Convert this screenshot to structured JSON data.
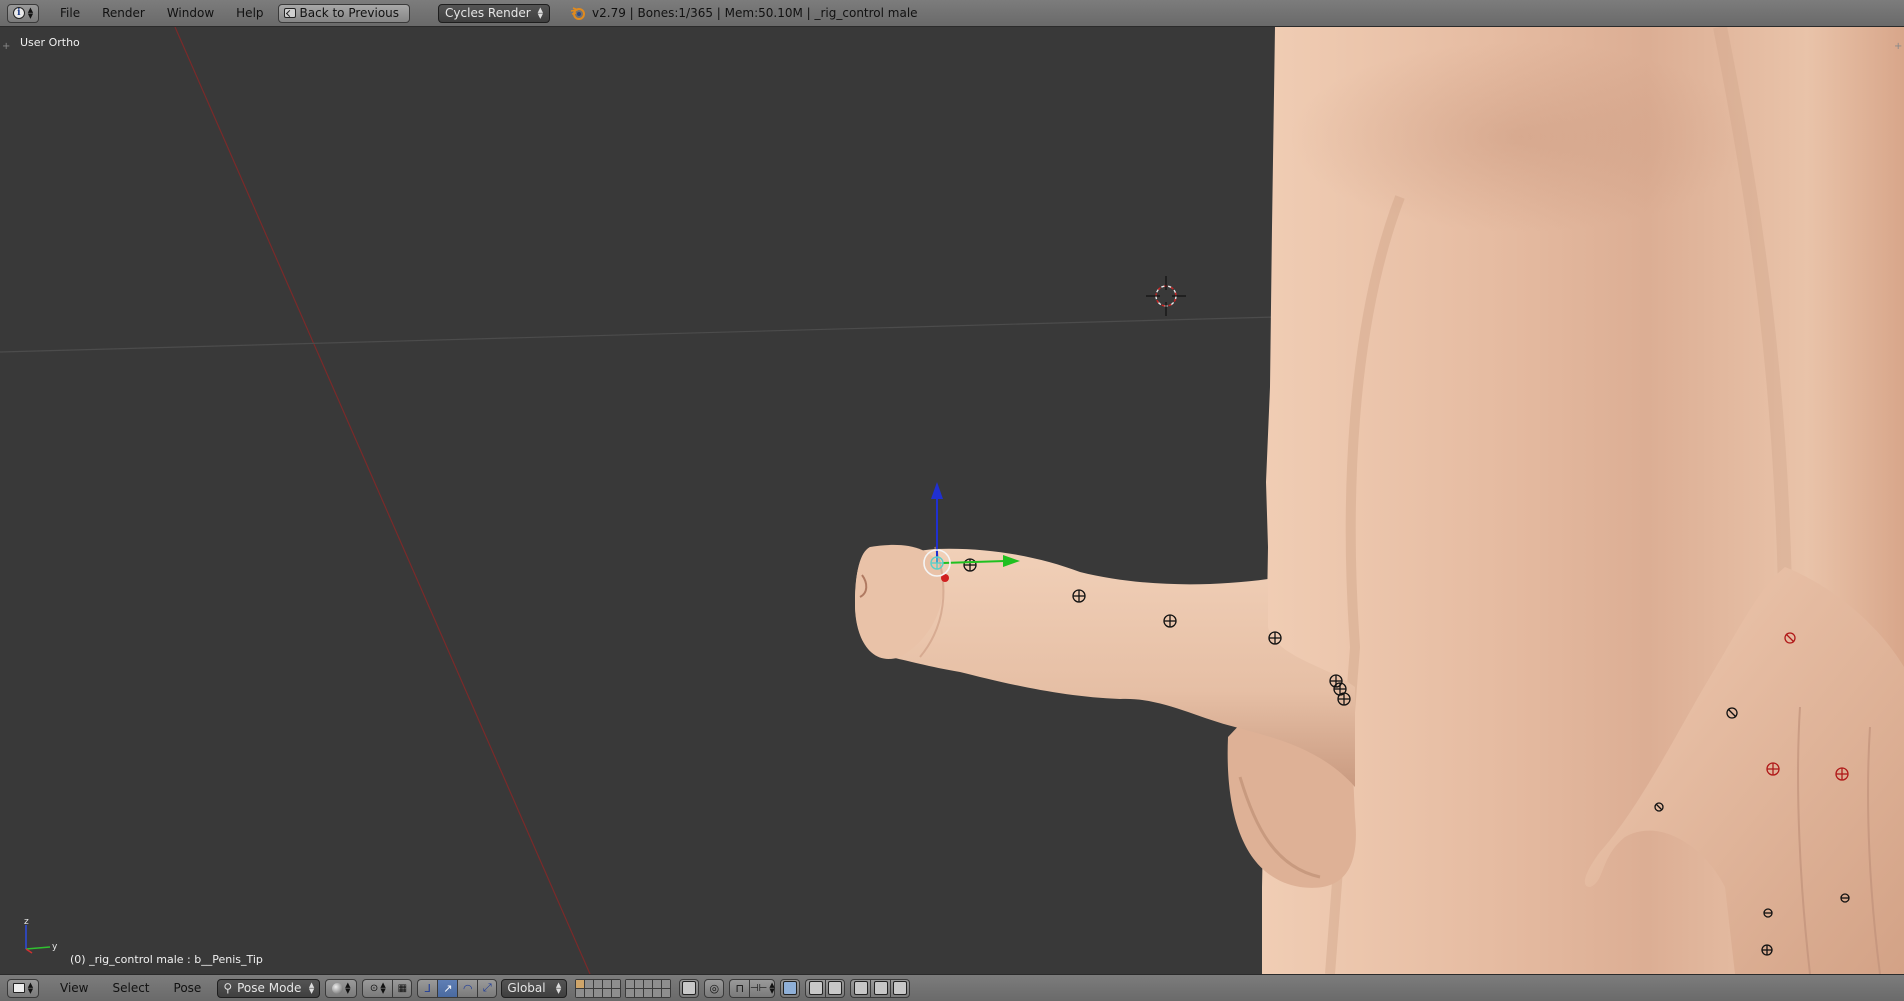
{
  "colors": {
    "viewport_bg": "#393939",
    "header_bg": "#727272",
    "skin": "#e8c2a8",
    "skin_shadow": "#c99a80",
    "axis_x": "#c02020",
    "axis_y": "#20c020",
    "axis_z": "#2030d0",
    "horizon": "#4a4a4a",
    "x_axis_line": "#7a2a2a"
  },
  "top_header": {
    "editor_type_icon": "info-icon",
    "menus": [
      "File",
      "Render",
      "Window",
      "Help"
    ],
    "back_button": "Back to Previous",
    "render_engine": "Cycles Render",
    "logo_icon": "blender-logo-icon",
    "stats": "v2.79 | Bones:1/365 | Mem:50.10M | _rig_control male"
  },
  "viewport": {
    "view_label": "User Ortho",
    "object_label": "(0) _rig_control male : b__Penis_Tip",
    "gizmo_axes": [
      "z",
      "y"
    ]
  },
  "bottom_header": {
    "editor_type_icon": "3d-view-icon",
    "menus": [
      "View",
      "Select",
      "Pose"
    ],
    "mode": "Pose Mode",
    "transform_orientation": "Global"
  }
}
